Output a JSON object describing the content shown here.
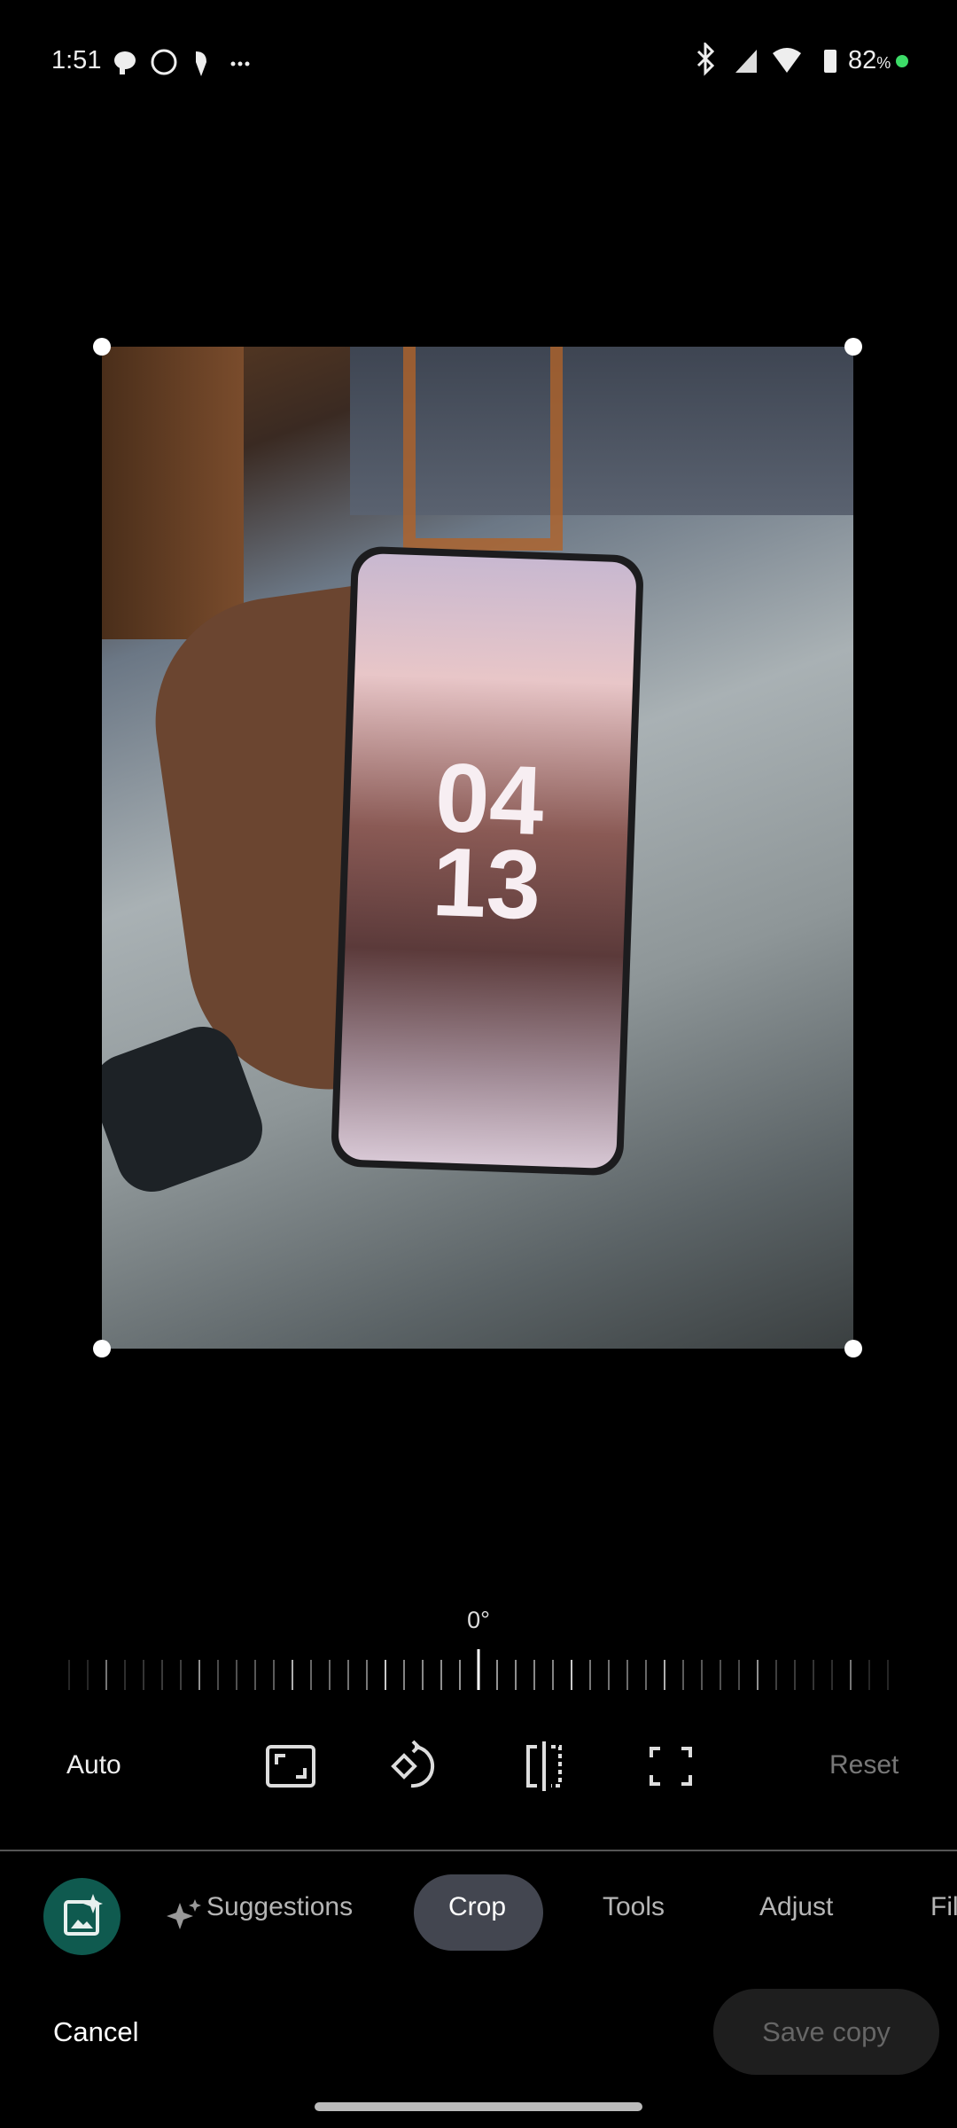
{
  "status_bar": {
    "time": "1:51",
    "battery": "82",
    "battery_unit": "%",
    "icons": [
      "chat-icon",
      "whatsapp-icon",
      "app-notification-icon",
      "more-icon",
      "bluetooth-icon",
      "signal-icon",
      "wifi-icon",
      "battery-icon",
      "privacy-dot"
    ]
  },
  "photo": {
    "clock_hour": "04",
    "clock_minute": "13"
  },
  "straighten": {
    "angle_label": "0°",
    "angle_value": 0
  },
  "crop_tools": {
    "auto": "Auto",
    "reset": "Reset",
    "icons": [
      "aspect-ratio-icon",
      "rotate-icon",
      "flip-icon",
      "free-crop-icon"
    ]
  },
  "tabs": [
    {
      "label": "Suggestions"
    },
    {
      "label": "Crop",
      "selected": true
    },
    {
      "label": "Tools"
    },
    {
      "label": "Adjust"
    },
    {
      "label": "Fil"
    }
  ],
  "actions": {
    "cancel": "Cancel",
    "save": "Save copy"
  },
  "colors": {
    "accent_fab": "#0f5a4f",
    "selected_tab": "#434650",
    "privacy_dot": "#3ddc68"
  }
}
